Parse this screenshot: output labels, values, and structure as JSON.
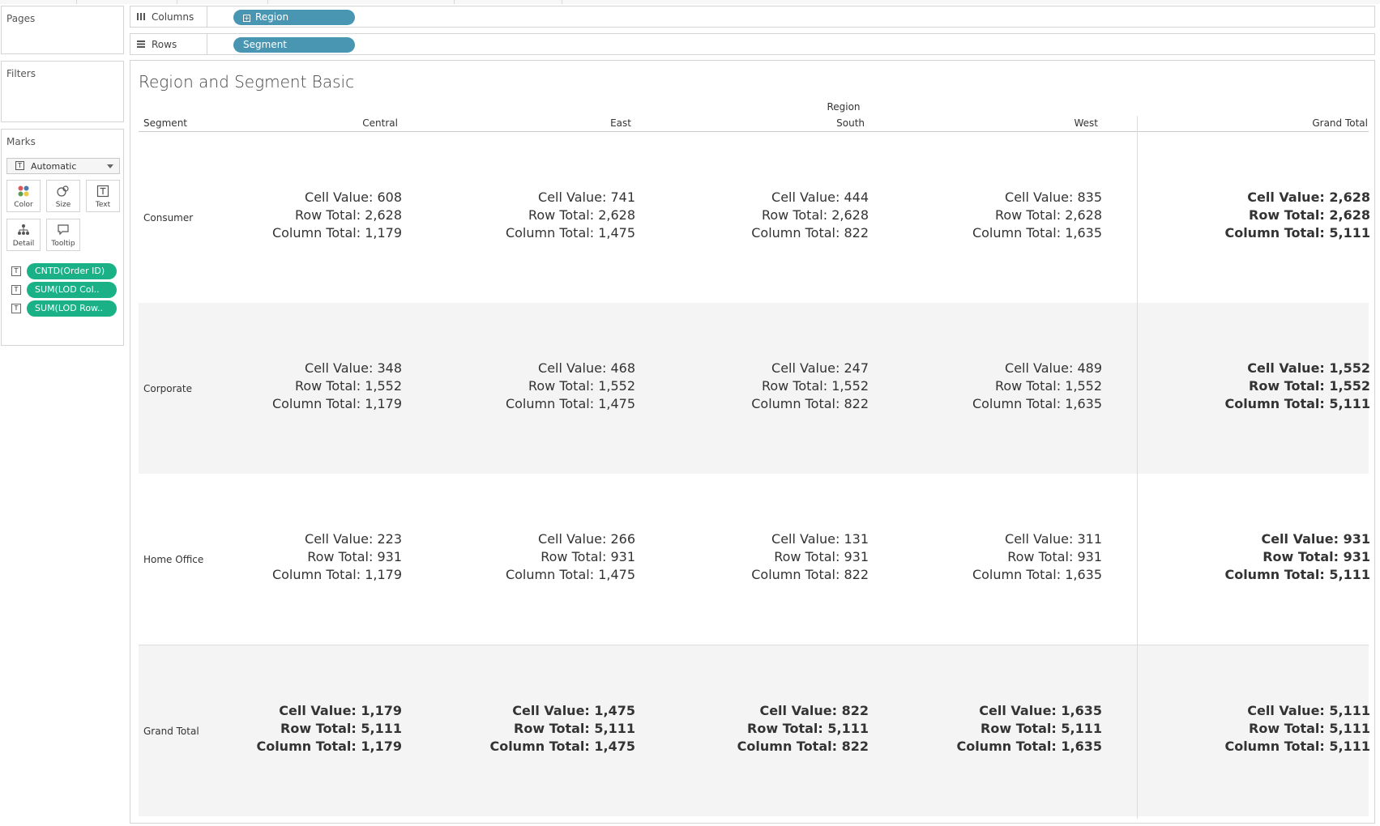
{
  "panels": {
    "pages_title": "Pages",
    "filters_title": "Filters",
    "marks_title": "Marks"
  },
  "marks": {
    "mark_type": "Automatic",
    "buttons": [
      {
        "label": "Color",
        "icon": "color-dots-icon"
      },
      {
        "label": "Size",
        "icon": "size-circles-icon"
      },
      {
        "label": "Text",
        "icon": "text-icon"
      },
      {
        "label": "Detail",
        "icon": "detail-icon"
      },
      {
        "label": "Tooltip",
        "icon": "tooltip-icon"
      }
    ],
    "pills": [
      "CNTD(Order ID)",
      "SUM(LOD Col..",
      "SUM(LOD Row.."
    ]
  },
  "shelves": {
    "columns_label": "Columns",
    "columns_pill": "Region",
    "rows_label": "Rows",
    "rows_pill": "Segment"
  },
  "view": {
    "title": "Region and Segment Basic",
    "column_group": "Region",
    "segment_header": "Segment",
    "columns": [
      "Central",
      "East",
      "South",
      "West",
      "Grand Total"
    ],
    "labels": {
      "cell": "Cell Value:",
      "row": "Row Total:",
      "col": "Column Total:"
    },
    "rows": [
      {
        "segment": "Consumer",
        "cells": [
          {
            "cell": "608",
            "row": "2,628",
            "col": "1,179"
          },
          {
            "cell": "741",
            "row": "2,628",
            "col": "1,475"
          },
          {
            "cell": "444",
            "row": "2,628",
            "col": "822"
          },
          {
            "cell": "835",
            "row": "2,628",
            "col": "1,635"
          },
          {
            "cell": "2,628",
            "row": "2,628",
            "col": "5,111"
          }
        ]
      },
      {
        "segment": "Corporate",
        "cells": [
          {
            "cell": "348",
            "row": "1,552",
            "col": "1,179"
          },
          {
            "cell": "468",
            "row": "1,552",
            "col": "1,475"
          },
          {
            "cell": "247",
            "row": "1,552",
            "col": "822"
          },
          {
            "cell": "489",
            "row": "1,552",
            "col": "1,635"
          },
          {
            "cell": "1,552",
            "row": "1,552",
            "col": "5,111"
          }
        ]
      },
      {
        "segment": "Home Office",
        "cells": [
          {
            "cell": "223",
            "row": "931",
            "col": "1,179"
          },
          {
            "cell": "266",
            "row": "931",
            "col": "1,475"
          },
          {
            "cell": "131",
            "row": "931",
            "col": "822"
          },
          {
            "cell": "311",
            "row": "931",
            "col": "1,635"
          },
          {
            "cell": "931",
            "row": "931",
            "col": "5,111"
          }
        ]
      },
      {
        "segment": "Grand Total",
        "cells": [
          {
            "cell": "1,179",
            "row": "5,111",
            "col": "1,179"
          },
          {
            "cell": "1,475",
            "row": "5,111",
            "col": "1,475"
          },
          {
            "cell": "822",
            "row": "5,111",
            "col": "822"
          },
          {
            "cell": "1,635",
            "row": "5,111",
            "col": "1,635"
          },
          {
            "cell": "5,111",
            "row": "5,111",
            "col": "5,111"
          }
        ]
      }
    ]
  },
  "colors": {
    "dimension_pill": "#4996b2",
    "measure_pill": "#1ab187",
    "band_shade": "#f4f4f4"
  }
}
